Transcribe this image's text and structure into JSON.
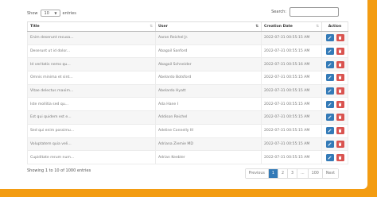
{
  "controls": {
    "show_label": "Show",
    "entries_value": "10",
    "entries_label": "entries",
    "search_label": "Search:",
    "search_value": ""
  },
  "columns": {
    "title": "Title",
    "user": "User",
    "date": "Creation Date",
    "action": "Action"
  },
  "rows": [
    {
      "title": "Enim deserunt recusa...",
      "user": "Aaron Reichel Jr.",
      "date": "2022-07-31 00:55:15 AM"
    },
    {
      "title": "Deserunt ut id dolor...",
      "user": "Abagail Sanford",
      "date": "2022-07-31 00:55:15 AM"
    },
    {
      "title": "Id veritatis nemo qu...",
      "user": "Abagail Schneider",
      "date": "2022-07-31 00:55:16 AM"
    },
    {
      "title": "Omnis minima et sint...",
      "user": "Abelardo Botsford",
      "date": "2022-07-31 00:55:15 AM"
    },
    {
      "title": "Vitae delectus maxim...",
      "user": "Abelardo Hyatt",
      "date": "2022-07-31 00:55:15 AM"
    },
    {
      "title": "Iste mollitia sed qu...",
      "user": "Ada Hane I",
      "date": "2022-07-31 00:55:15 AM"
    },
    {
      "title": "Est qui quidem est e...",
      "user": "Addison Reichel",
      "date": "2022-07-31 00:55:15 AM"
    },
    {
      "title": "Sed qui enim possimu...",
      "user": "Adeline Connelly III",
      "date": "2022-07-31 00:55:15 AM"
    },
    {
      "title": "Voluptatem quia veli...",
      "user": "Adriana Ziemie MD",
      "date": "2022-07-31 00:55:15 AM"
    },
    {
      "title": "Cupiditate rerum num...",
      "user": "Adrian Keebler",
      "date": "2022-07-31 00:55:15 AM"
    }
  ],
  "footer": {
    "info": "Showing 1 to 10 of 1000 entries",
    "pages": [
      "Previous",
      "1",
      "2",
      "3",
      "...",
      "100",
      "Next"
    ],
    "current_page": "1"
  },
  "colors": {
    "background": "#f39c12",
    "edit_button": "#337ab7",
    "delete_button": "#d9534f"
  },
  "icons": {
    "edit": "pencil-edit-icon",
    "delete": "trash-icon"
  }
}
